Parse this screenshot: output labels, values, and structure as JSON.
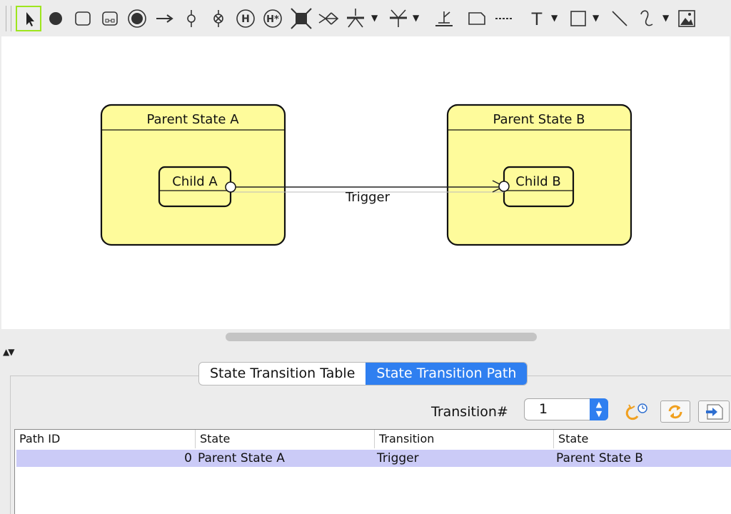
{
  "toolbar": {
    "tools": [
      {
        "name": "select-pointer-icon",
        "selected": true
      },
      {
        "name": "initial-state-icon"
      },
      {
        "name": "simple-state-icon"
      },
      {
        "name": "composite-state-icon"
      },
      {
        "name": "final-state-icon"
      },
      {
        "name": "transition-arrow-icon"
      },
      {
        "name": "choice-point-icon"
      },
      {
        "name": "terminate-point-icon"
      },
      {
        "name": "shallow-history-icon"
      },
      {
        "name": "deep-history-icon"
      },
      {
        "name": "fork-join-icon"
      },
      {
        "name": "junction-icon"
      },
      {
        "name": "fork-icon"
      },
      {
        "name": "join-icon"
      },
      {
        "name": "anchor-icon"
      },
      {
        "name": "note-icon"
      },
      {
        "name": "note-link-icon"
      },
      {
        "name": "text-icon"
      },
      {
        "name": "rectangle-icon"
      },
      {
        "name": "line-icon"
      },
      {
        "name": "curve-icon"
      },
      {
        "name": "image-icon"
      }
    ],
    "text_tool_glyph": "T",
    "history_glyph": "H",
    "deep_history_glyph": "H*"
  },
  "diagram": {
    "parent_a": {
      "title": "Parent State A",
      "child": "Child A"
    },
    "parent_b": {
      "title": "Parent State B",
      "child": "Child B"
    },
    "transition_label": "Trigger",
    "state_fill": "#fefb9b"
  },
  "bottom": {
    "tabs": [
      "State Transition Table",
      "State Transition Path"
    ],
    "active_tab": 1,
    "transition_label": "Transition#",
    "transition_value": "1",
    "table": {
      "columns": [
        "Path ID",
        "State",
        "Transition",
        "State"
      ],
      "rows": [
        [
          "0",
          "Parent State A",
          "Trigger",
          "Parent State B"
        ]
      ]
    }
  },
  "colors": {
    "accent": "#2f7ff0",
    "selection_row": "#cbcbf7",
    "tool_selected_border": "#9ee51e"
  }
}
